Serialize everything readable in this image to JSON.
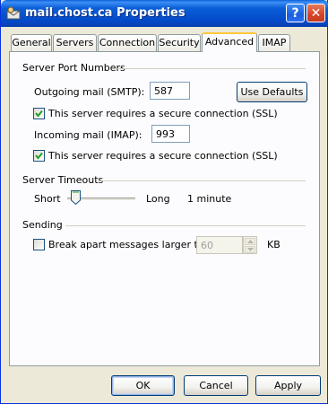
{
  "window": {
    "title": "mail.chost.ca Properties",
    "help_label": "?",
    "close_label": "✕"
  },
  "tabs": [
    {
      "label": "General"
    },
    {
      "label": "Servers"
    },
    {
      "label": "Connection"
    },
    {
      "label": "Security"
    },
    {
      "label": "Advanced",
      "active": true
    },
    {
      "label": "IMAP"
    }
  ],
  "server_ports": {
    "group_title": "Server Port Numbers",
    "outgoing_label": "Outgoing mail (SMTP):",
    "outgoing_value": "587",
    "use_defaults_label": "Use Defaults",
    "smtp_ssl_label": "This server requires a secure connection (SSL)",
    "smtp_ssl_checked": true,
    "incoming_label": "Incoming mail (IMAP):",
    "incoming_value": "993",
    "imap_ssl_label": "This server requires a secure connection (SSL)",
    "imap_ssl_checked": true
  },
  "timeouts": {
    "group_title": "Server Timeouts",
    "short_label": "Short",
    "long_label": "Long",
    "value_text": "1 minute",
    "level": 0.0
  },
  "sending": {
    "group_title": "Sending",
    "break_label": "Break apart messages larger than",
    "break_checked": false,
    "size_value": "60",
    "unit_label": "KB"
  },
  "buttons": {
    "ok": "OK",
    "cancel": "Cancel",
    "apply": "Apply"
  }
}
